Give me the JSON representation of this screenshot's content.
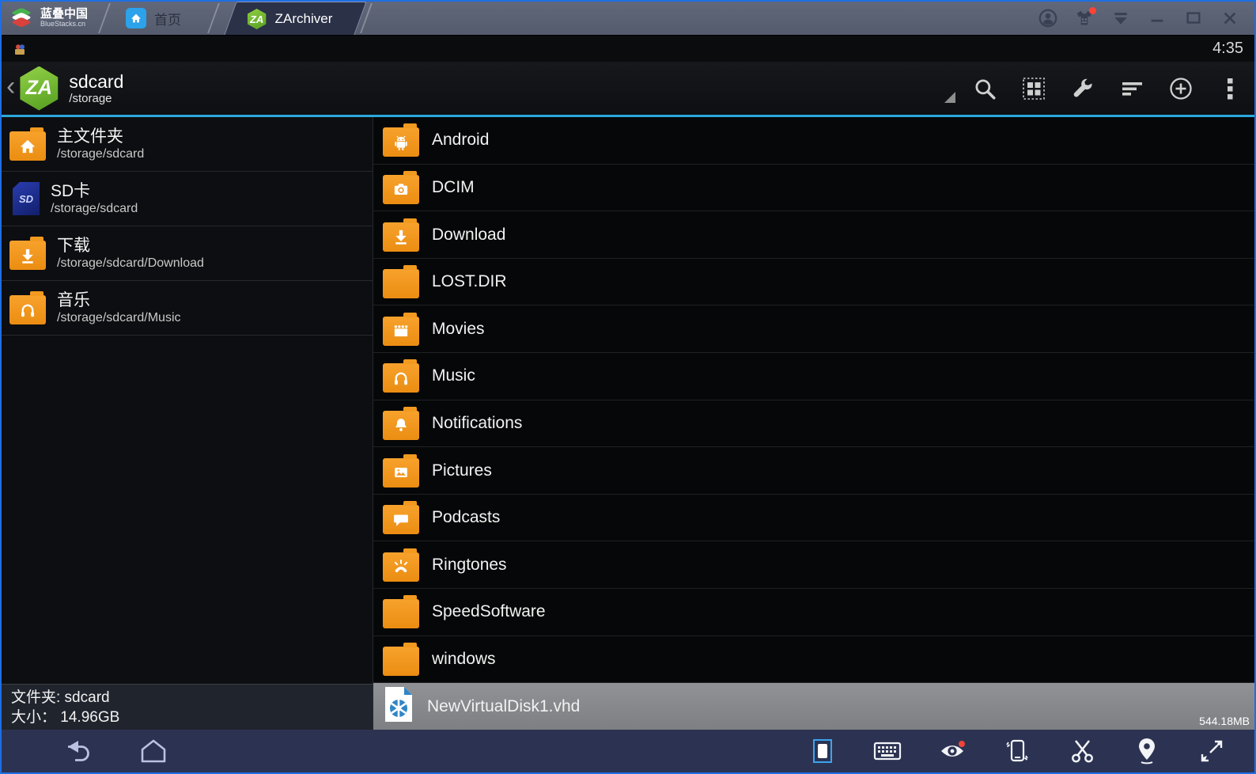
{
  "tabbar": {
    "brand": {
      "title": "蓝叠中国",
      "subtitle": "BlueStacks.cn"
    },
    "tabs": [
      {
        "label": "首页",
        "icon": "home"
      },
      {
        "label": "ZArchiver",
        "icon": "zarchiver",
        "active": true
      }
    ],
    "controls": [
      "account",
      "store",
      "dropdown",
      "minimize",
      "maximize",
      "close"
    ]
  },
  "statusbar": {
    "time": "4:35"
  },
  "toolbar": {
    "title": "sdcard",
    "subtitle": "/storage",
    "logo_text": "ZA",
    "actions": [
      "search",
      "multiselect",
      "tools",
      "sort",
      "add-archive",
      "overflow-menu"
    ],
    "accent_color": "#2ba8db"
  },
  "sidebar": {
    "items": [
      {
        "label": "主文件夹",
        "path": "/storage/sdcard",
        "icon": "folder-home"
      },
      {
        "label": "SD卡",
        "path": "/storage/sdcard",
        "icon": "sdcard"
      },
      {
        "label": "下载",
        "path": "/storage/sdcard/Download",
        "icon": "folder-download"
      },
      {
        "label": "音乐",
        "path": "/storage/sdcard/Music",
        "icon": "folder-music"
      }
    ]
  },
  "filelist": {
    "rows": [
      {
        "name": "Android",
        "icon": "folder-android"
      },
      {
        "name": "DCIM",
        "icon": "folder-camera"
      },
      {
        "name": "Download",
        "icon": "folder-download"
      },
      {
        "name": "LOST.DIR",
        "icon": "folder-plain"
      },
      {
        "name": "Movies",
        "icon": "folder-movies"
      },
      {
        "name": "Music",
        "icon": "folder-music"
      },
      {
        "name": "Notifications",
        "icon": "folder-bell"
      },
      {
        "name": "Pictures",
        "icon": "folder-picture"
      },
      {
        "name": "Podcasts",
        "icon": "folder-podcast"
      },
      {
        "name": "Ringtones",
        "icon": "folder-ringtone"
      },
      {
        "name": "SpeedSoftware",
        "icon": "folder-plain"
      },
      {
        "name": "windows",
        "icon": "folder-plain"
      },
      {
        "name": "NewVirtualDisk1.vhd",
        "icon": "vhd-file",
        "selected": true,
        "size": "544.18MB"
      }
    ]
  },
  "statuspanel": {
    "folder_line": "文件夹: sdcard",
    "size_line": "大小： 14.96GB"
  },
  "navbar": {
    "left": [
      "back",
      "home"
    ],
    "right": [
      "screen-portrait",
      "keyboard",
      "eye",
      "shake",
      "scissors",
      "location",
      "fullscreen"
    ]
  },
  "colors": {
    "folder_orange": "#f1941f",
    "selection_gray": "#85878b",
    "holo_accent": "#2ba8db",
    "window_border": "#1e6fe3",
    "navbar_bg": "#2c3352"
  }
}
